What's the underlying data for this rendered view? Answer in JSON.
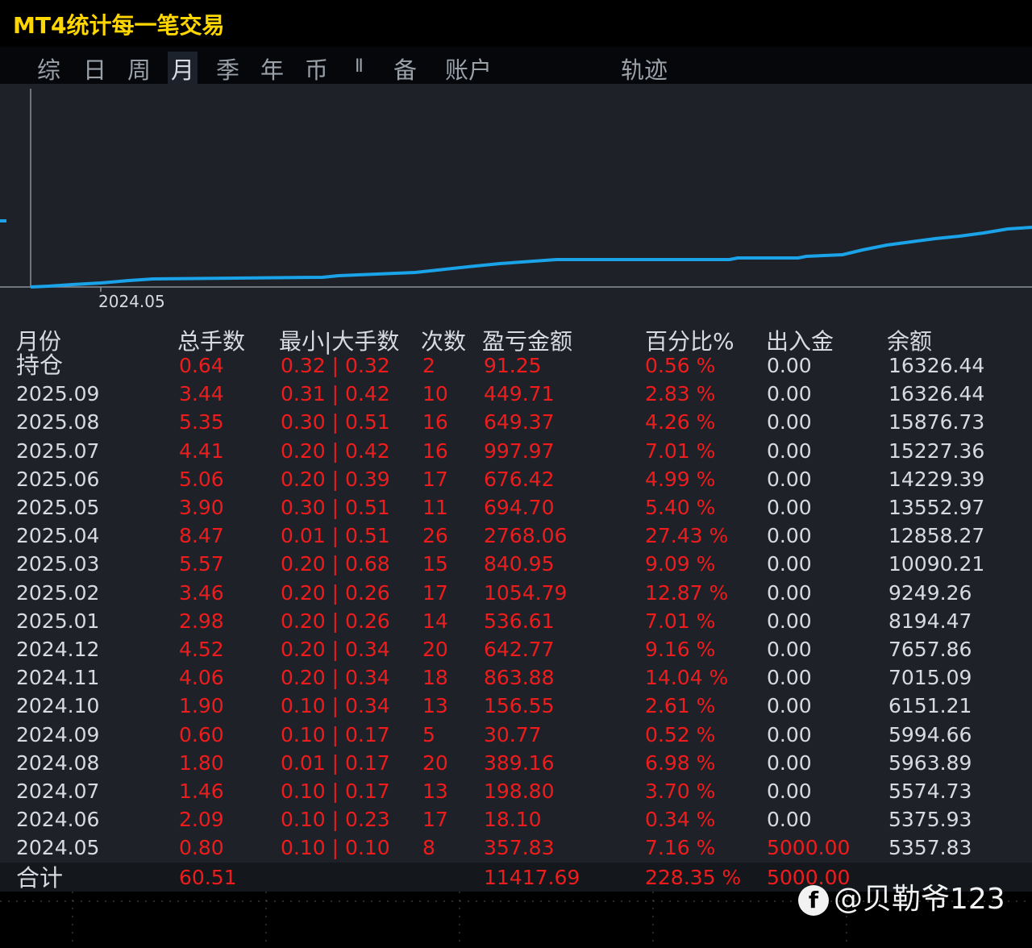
{
  "app_title": "MT4统计每一笔交易",
  "tabs": [
    "综",
    "日",
    "周",
    "月",
    "季",
    "年",
    "币",
    "Ⅱ",
    "备",
    "账户",
    "轨迹"
  ],
  "active_tab": "月",
  "chart_data": {
    "type": "line",
    "x_tick_labels": [
      "2024.05"
    ],
    "colors": {
      "line": "#1aa3e8",
      "axis": "#8a8f96"
    }
  },
  "table": {
    "headers": [
      "月份",
      "总手数",
      "最小|大手数",
      "次数",
      "盈亏金额",
      "百分比%",
      "出入金",
      "余额"
    ],
    "rows": [
      [
        "持仓",
        "0.64",
        "0.32 | 0.32",
        "2",
        "91.25",
        "0.56 %",
        "0.00",
        "16326.44"
      ],
      [
        "2025.09",
        "3.44",
        "0.31 | 0.42",
        "10",
        "449.71",
        "2.83 %",
        "0.00",
        "16326.44"
      ],
      [
        "2025.08",
        "5.35",
        "0.30 | 0.51",
        "16",
        "649.37",
        "4.26 %",
        "0.00",
        "15876.73"
      ],
      [
        "2025.07",
        "4.41",
        "0.20 | 0.42",
        "16",
        "997.97",
        "7.01 %",
        "0.00",
        "15227.36"
      ],
      [
        "2025.06",
        "5.06",
        "0.20 | 0.39",
        "17",
        "676.42",
        "4.99 %",
        "0.00",
        "14229.39"
      ],
      [
        "2025.05",
        "3.90",
        "0.30 | 0.51",
        "11",
        "694.70",
        "5.40 %",
        "0.00",
        "13552.97"
      ],
      [
        "2025.04",
        "8.47",
        "0.01 | 0.51",
        "26",
        "2768.06",
        "27.43 %",
        "0.00",
        "12858.27"
      ],
      [
        "2025.03",
        "5.57",
        "0.20 | 0.68",
        "15",
        "840.95",
        "9.09 %",
        "0.00",
        "10090.21"
      ],
      [
        "2025.02",
        "3.46",
        "0.20 | 0.26",
        "17",
        "1054.79",
        "12.87 %",
        "0.00",
        "9249.26"
      ],
      [
        "2025.01",
        "2.98",
        "0.20 | 0.26",
        "14",
        "536.61",
        "7.01 %",
        "0.00",
        "8194.47"
      ],
      [
        "2024.12",
        "4.52",
        "0.20 | 0.34",
        "20",
        "642.77",
        "9.16 %",
        "0.00",
        "7657.86"
      ],
      [
        "2024.11",
        "4.06",
        "0.20 | 0.34",
        "18",
        "863.88",
        "14.04 %",
        "0.00",
        "7015.09"
      ],
      [
        "2024.10",
        "1.90",
        "0.10 | 0.34",
        "13",
        "156.55",
        "2.61 %",
        "0.00",
        "6151.21"
      ],
      [
        "2024.09",
        "0.60",
        "0.10 | 0.17",
        "5",
        "30.77",
        "0.52 %",
        "0.00",
        "5994.66"
      ],
      [
        "2024.08",
        "1.80",
        "0.01 | 0.17",
        "20",
        "389.16",
        "6.98 %",
        "0.00",
        "5963.89"
      ],
      [
        "2024.07",
        "1.46",
        "0.10 | 0.17",
        "13",
        "198.80",
        "3.70 %",
        "0.00",
        "5574.73"
      ],
      [
        "2024.06",
        "2.09",
        "0.10 | 0.23",
        "17",
        "18.10",
        "0.34 %",
        "0.00",
        "5375.93"
      ],
      [
        "2024.05",
        "0.80",
        "0.10 | 0.10",
        "8",
        "357.83",
        "7.16 %",
        "5000.00",
        "5357.83"
      ]
    ],
    "total": [
      "合计",
      "60.51",
      "",
      "",
      "11417.69",
      "228.35 %",
      "5000.00",
      ""
    ]
  },
  "watermark": "@贝勒爷123",
  "watermark_icon": "f"
}
